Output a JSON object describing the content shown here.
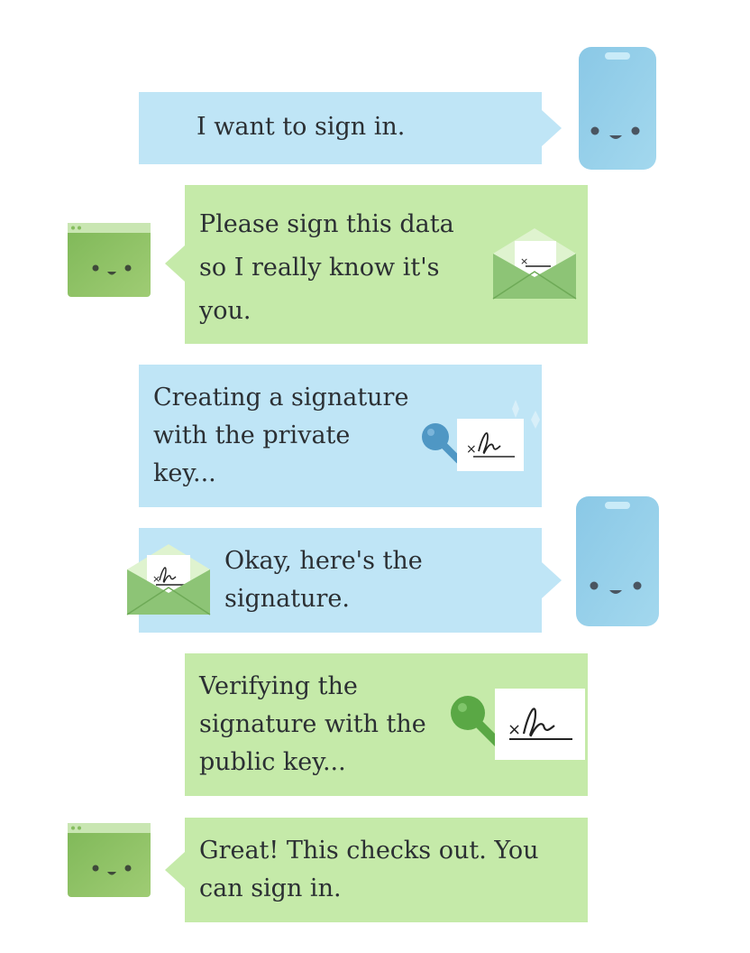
{
  "messages": [
    {
      "id": "m1",
      "speaker": "device",
      "text": "I want to sign in."
    },
    {
      "id": "m2",
      "speaker": "server",
      "text": "Please sign this data so I really know it's you."
    },
    {
      "id": "m3",
      "speaker": "device",
      "text": "Creating a signature with the private key..."
    },
    {
      "id": "m4",
      "speaker": "device",
      "text": "Okay, here's the signature."
    },
    {
      "id": "m5",
      "speaker": "server",
      "text": "Verifying the signature with the public key..."
    },
    {
      "id": "m6",
      "speaker": "server",
      "text": "Great! This checks out. You can sign in."
    }
  ],
  "colors": {
    "device_bubble": "#bfe5f6",
    "server_bubble": "#c5eaa9",
    "phone": "#8ecbe8",
    "browser": "#86bd5f",
    "private_key": "#4f97c4",
    "public_key": "#5aa845"
  },
  "icons": [
    "phone-avatar-icon",
    "browser-avatar-icon",
    "envelope-icon",
    "private-key-icon",
    "public-key-icon",
    "signature-card-icon",
    "sparkle-icon"
  ],
  "signature_mark": "×"
}
